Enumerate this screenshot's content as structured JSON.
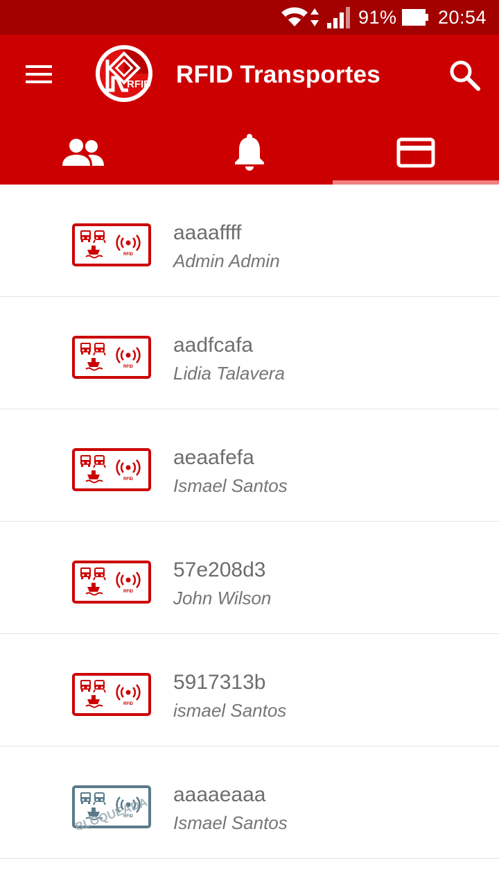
{
  "status_bar": {
    "battery_percent": "91%",
    "time": "20:54",
    "icons": [
      "wifi-icon",
      "data-arrows-icon",
      "signal-icon",
      "battery-icon"
    ]
  },
  "app_bar": {
    "title": "RFID Transportes",
    "logo_text": "RFID",
    "icons": [
      "menu-icon",
      "search-icon"
    ]
  },
  "tabs": [
    {
      "icon": "people-icon",
      "selected": false
    },
    {
      "icon": "bell-icon",
      "selected": false
    },
    {
      "icon": "card-icon",
      "selected": true
    }
  ],
  "cards": [
    {
      "code": "aaaaffff",
      "owner": "Admin Admin",
      "status": "active"
    },
    {
      "code": "aadfcafa",
      "owner": "Lidia Talavera",
      "status": "active"
    },
    {
      "code": "aeaafefa",
      "owner": "Ismael Santos",
      "status": "active"
    },
    {
      "code": "57e208d3",
      "owner": "John Wilson",
      "status": "active"
    },
    {
      "code": "5917313b",
      "owner": "ismael Santos",
      "status": "active"
    },
    {
      "code": "aaaaeaaa",
      "owner": "Ismael Santos",
      "status": "blocked",
      "stamp": "BLOQUEADA"
    }
  ],
  "card_icon_labels": {
    "rfid": "RFID"
  },
  "colors": {
    "status_bar": "#a30000",
    "primary": "#cc0000",
    "tab_indicator": "#f08080",
    "card_active": "#cc0000",
    "card_blocked": "#5a7a8a",
    "title_text": "#6d6d6d",
    "subtitle_text": "#757575"
  }
}
